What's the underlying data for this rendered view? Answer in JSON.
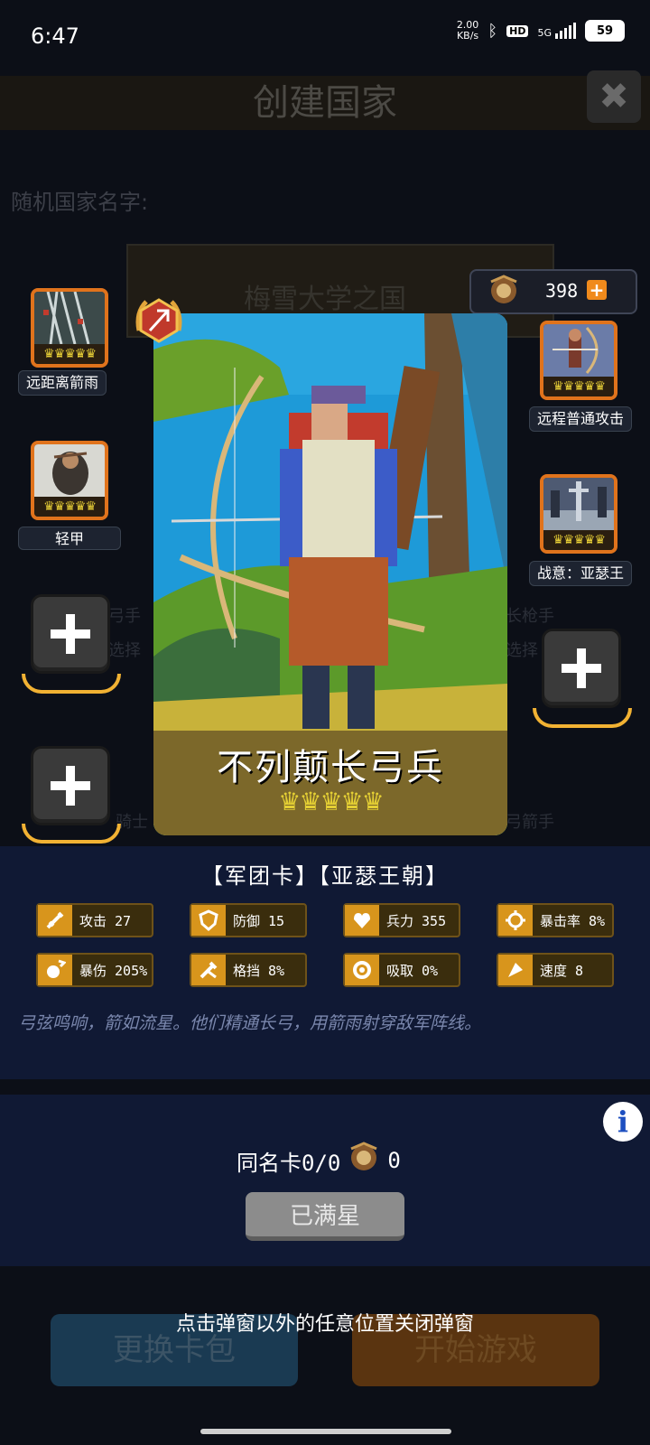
{
  "status_bar": {
    "time": "6:47",
    "net_speed": "2.00",
    "net_unit": "KB/s",
    "hd": "HD",
    "signal": "5G",
    "battery": "59"
  },
  "background": {
    "title": "创建国家",
    "random_name_label": "随机国家名字:",
    "country_name": "梅雪大学之国",
    "ghost_left_1": "弓手",
    "ghost_left_2": "选择",
    "ghost_right_1": "长枪手",
    "ghost_right_2": "选择",
    "ghost_left_3": "骑士",
    "ghost_right_3": "弓箭手",
    "change_pack_button": "更换卡包",
    "start_game_button": "开始游戏"
  },
  "currency": {
    "amount": "398",
    "add": "+"
  },
  "skills_left": [
    {
      "label": "远距离箭雨",
      "crowns": "♛♛♛♛♛"
    },
    {
      "label": "轻甲",
      "crowns": "♛♛♛♛♛"
    }
  ],
  "skills_right": [
    {
      "label": "远程普通攻击",
      "crowns": "♛♛♛♛♛"
    },
    {
      "label": "战意：亚瑟王",
      "crowns": "♛♛♛♛♛"
    }
  ],
  "card": {
    "name": "不列颠长弓兵",
    "stars": "♛♛♛♛♛"
  },
  "tags": "【军团卡】【亚瑟王朝】",
  "stats": [
    {
      "icon": "sword-icon",
      "text": "攻击 27"
    },
    {
      "icon": "shield-icon",
      "text": "防御 15"
    },
    {
      "icon": "heart-icon",
      "text": "兵力 355"
    },
    {
      "icon": "crit-rate-icon",
      "text": "暴击率 8%"
    },
    {
      "icon": "crit-damage-icon",
      "text": "暴伤 205%"
    },
    {
      "icon": "parry-icon",
      "text": "格挡 8%"
    },
    {
      "icon": "lifesteal-icon",
      "text": "吸取 0%"
    },
    {
      "icon": "speed-icon",
      "text": "速度 8"
    }
  ],
  "description": "弓弦鸣响，箭如流星。他们精通长弓，用箭雨射穿敌军阵线。",
  "duplicate": {
    "label": "同名卡0/0",
    "count": "0"
  },
  "maxed_button": "已满星",
  "close_hint": "点击弹窗以外的任意位置关闭弹窗"
}
